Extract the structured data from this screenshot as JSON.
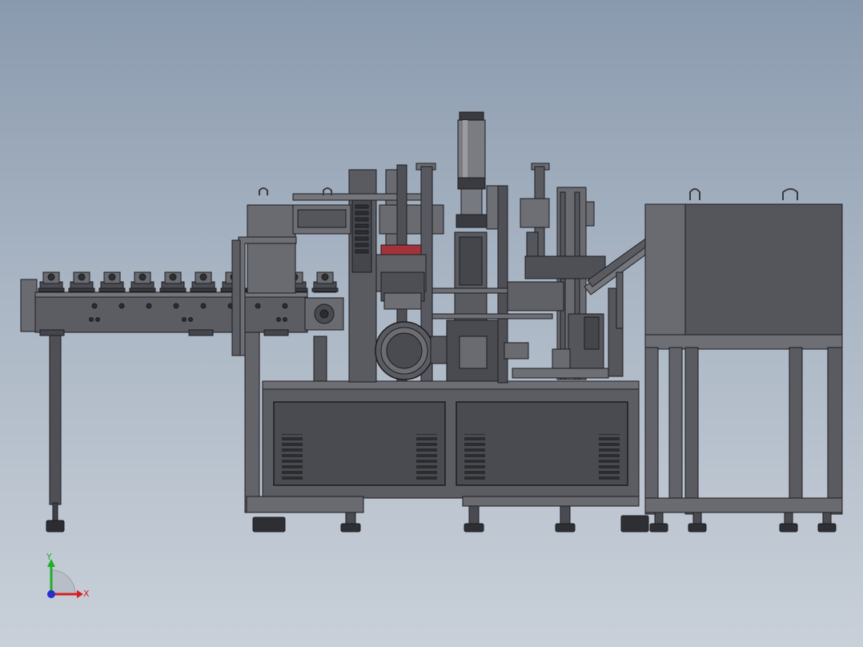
{
  "viewport": {
    "background_top": "#8a9aae",
    "background_bottom": "#c9d0d9",
    "model_fill": "#5c5d63",
    "model_dark": "#3f4046",
    "model_light": "#74767c",
    "edge_color": "#1c1c20"
  },
  "triad": {
    "x_label": "X",
    "y_label": "Y",
    "x_color": "#d42020",
    "y_color": "#1fae2a",
    "z_color": "#2730c8"
  }
}
